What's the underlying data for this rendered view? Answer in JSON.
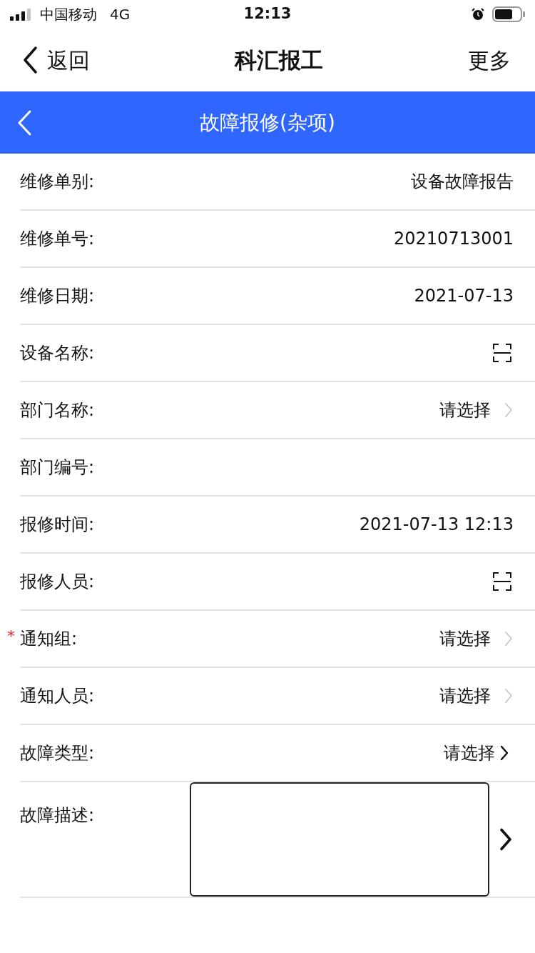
{
  "status_bar": {
    "carrier": "中国移动",
    "network": "4G",
    "time": "12:13"
  },
  "nav": {
    "back": "返回",
    "title": "科汇报工",
    "more": "更多"
  },
  "header": {
    "title": "故障报修(杂项)"
  },
  "rows": [
    {
      "kind": "text",
      "label": "维修单别:",
      "value": "设备故障报告"
    },
    {
      "kind": "text",
      "label": "维修单号:",
      "value": "20210713001"
    },
    {
      "kind": "text",
      "label": "维修日期:",
      "value": "2021-07-13"
    },
    {
      "kind": "scan",
      "label": "设备名称:"
    },
    {
      "kind": "select",
      "label": "部门名称:",
      "value": "请选择"
    },
    {
      "kind": "empty",
      "label": "部门编号:"
    },
    {
      "kind": "text",
      "label": "报修时间:",
      "value": "2021-07-13 12:13"
    },
    {
      "kind": "scan",
      "label": "报修人员:"
    },
    {
      "kind": "select",
      "label": "通知组:",
      "value": "请选择",
      "required_mark": "*"
    },
    {
      "kind": "select",
      "label": "通知人员:",
      "value": "请选择"
    },
    {
      "kind": "picker",
      "label": "故障类型:",
      "value": "请选择"
    },
    {
      "kind": "textarea",
      "label": "故障描述:"
    }
  ]
}
